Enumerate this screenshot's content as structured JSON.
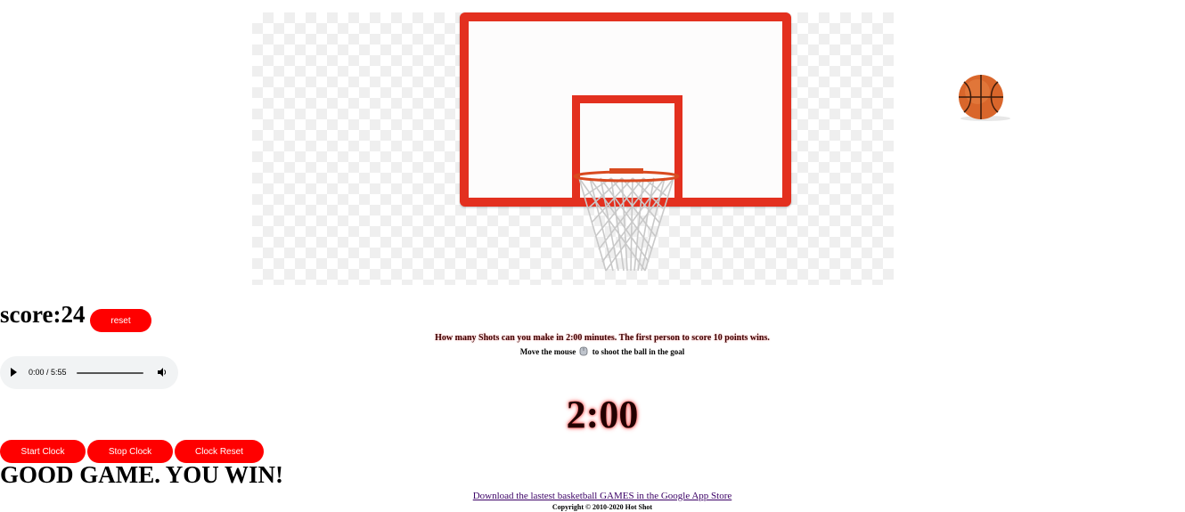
{
  "score": {
    "label": "score:24"
  },
  "reset_label": "reset",
  "instructions": "How many Shots can you make in 2:00 minutes. The first person to score 10 points wins.",
  "mouse_hint": {
    "before": "Move the mouse",
    "after": "to shoot the ball in the goal"
  },
  "audio": {
    "time": "0:00 / 5:55"
  },
  "clock": "2:00",
  "buttons": {
    "start": "Start Clock",
    "stop": "Stop Clock",
    "reset": "Clock Reset"
  },
  "message": "GOOD GAME. YOU WIN!",
  "footer": {
    "link": "Download the lastest basketball GAMES in the Google App Store",
    "copyright": "Copyright © 2010-2020 Hot Shot"
  },
  "colors": {
    "accent": "#ff0000",
    "backboard": "#e3301f",
    "ball": "#d9662b"
  },
  "icons": {
    "ball": "basketball-icon",
    "mouse": "mouse-icon",
    "play": "play-icon",
    "volume": "volume-icon"
  }
}
